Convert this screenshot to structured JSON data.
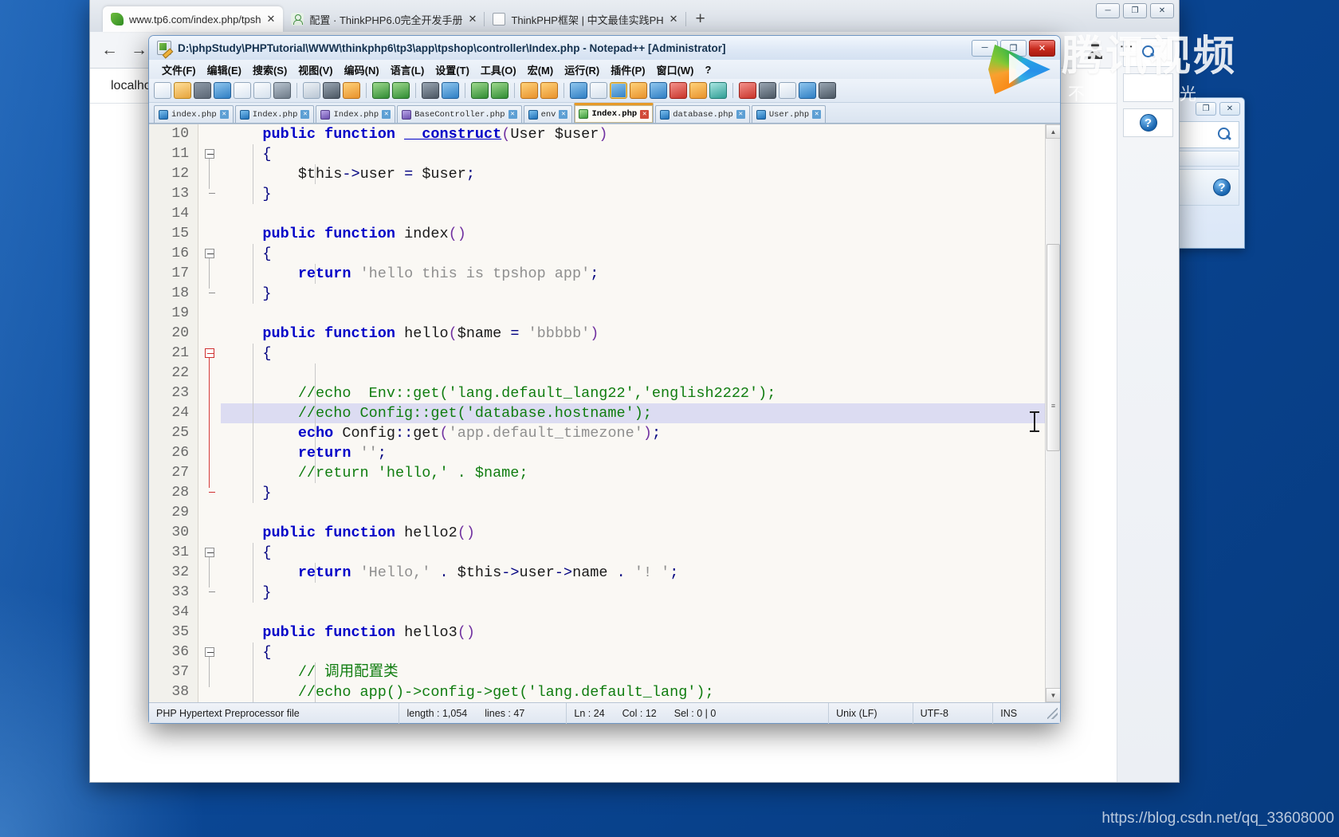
{
  "browser": {
    "tabs": [
      {
        "label": "www.tp6.com/index.php/tpsh",
        "icon": "leaf-icon",
        "active": true
      },
      {
        "label": "配置 · ThinkPHP6.0完全开发手册",
        "icon": "person-icon",
        "active": false
      },
      {
        "label": "ThinkPHP框架 | 中文最佳实践PH",
        "icon": "document-icon",
        "active": false
      }
    ],
    "newtab_label": "+",
    "close_label": "✕",
    "back_label": "←",
    "forward_label": "→",
    "urlbar_value": "localho",
    "window_controls": {
      "minimize": "─",
      "maximize": "❐",
      "close": "✕"
    }
  },
  "notepad": {
    "title": "D:\\phpStudy\\PHPTutorial\\WWW\\thinkphp6\\tp3\\app\\tpshop\\controller\\Index.php - Notepad++ [Administrator]",
    "window_controls": {
      "minimize": "─",
      "maximize": "❐",
      "close": "✕"
    },
    "menu": [
      "文件(F)",
      "编辑(E)",
      "搜索(S)",
      "视图(V)",
      "编码(N)",
      "语言(L)",
      "设置(T)",
      "工具(O)",
      "宏(M)",
      "运行(R)",
      "插件(P)",
      "窗口(W)",
      "?"
    ],
    "file_tabs": [
      {
        "label": "index.php",
        "icon_color": "blue",
        "active": false
      },
      {
        "label": "Index.php",
        "icon_color": "blue",
        "active": false
      },
      {
        "label": "Index.php",
        "icon_color": "purple",
        "active": false
      },
      {
        "label": "BaseController.php",
        "icon_color": "purple",
        "active": false
      },
      {
        "label": "env",
        "icon_color": "blue",
        "active": false
      },
      {
        "label": "Index.php",
        "icon_color": "green",
        "active": true
      },
      {
        "label": "database.php",
        "icon_color": "blue",
        "active": false
      },
      {
        "label": "User.php",
        "icon_color": "blue",
        "active": false
      }
    ],
    "tab_close_glyph": "✕",
    "status": {
      "file_type": "PHP Hypertext Preprocessor file",
      "length_label": "length : 1,054",
      "lines_label": "lines : 47",
      "ln_label": "Ln : 24",
      "col_label": "Col : 12",
      "sel_label": "Sel : 0 | 0",
      "eol": "Unix (LF)",
      "encoding": "UTF-8",
      "insert_mode": "INS"
    },
    "scrollbar": {
      "up_arrow": "▲",
      "down_arrow": "▼",
      "marker": "≡"
    },
    "code": [
      {
        "n": "10",
        "fold": "none",
        "hl": false,
        "tokens": [
          {
            "t": "    ",
            "c": "plain"
          },
          {
            "t": "public",
            "c": "kw"
          },
          {
            "t": " ",
            "c": "plain"
          },
          {
            "t": "function",
            "c": "kw"
          },
          {
            "t": " ",
            "c": "plain"
          },
          {
            "t": "__construct",
            "c": "ctor"
          },
          {
            "t": "(",
            "c": "paren"
          },
          {
            "t": "User ",
            "c": "id"
          },
          {
            "t": "$user",
            "c": "var"
          },
          {
            "t": ")",
            "c": "paren"
          }
        ]
      },
      {
        "n": "11",
        "fold": "open",
        "hl": false,
        "tokens": [
          {
            "t": "    ",
            "c": "plain"
          },
          {
            "t": "{",
            "c": "op"
          }
        ]
      },
      {
        "n": "12",
        "fold": "bar",
        "hl": false,
        "tokens": [
          {
            "t": "        ",
            "c": "plain"
          },
          {
            "t": "$this",
            "c": "var"
          },
          {
            "t": "->",
            "c": "op"
          },
          {
            "t": "user",
            "c": "id"
          },
          {
            "t": " ",
            "c": "plain"
          },
          {
            "t": "=",
            "c": "op"
          },
          {
            "t": " ",
            "c": "plain"
          },
          {
            "t": "$user",
            "c": "var"
          },
          {
            "t": ";",
            "c": "op"
          }
        ]
      },
      {
        "n": "13",
        "fold": "end",
        "hl": false,
        "tokens": [
          {
            "t": "    ",
            "c": "plain"
          },
          {
            "t": "}",
            "c": "op"
          }
        ]
      },
      {
        "n": "14",
        "fold": "none",
        "hl": false,
        "tokens": []
      },
      {
        "n": "15",
        "fold": "none",
        "hl": false,
        "tokens": [
          {
            "t": "    ",
            "c": "plain"
          },
          {
            "t": "public",
            "c": "kw"
          },
          {
            "t": " ",
            "c": "plain"
          },
          {
            "t": "function",
            "c": "kw"
          },
          {
            "t": " ",
            "c": "plain"
          },
          {
            "t": "index",
            "c": "fn"
          },
          {
            "t": "()",
            "c": "paren"
          }
        ]
      },
      {
        "n": "16",
        "fold": "open",
        "hl": false,
        "tokens": [
          {
            "t": "    ",
            "c": "plain"
          },
          {
            "t": "{",
            "c": "op"
          }
        ]
      },
      {
        "n": "17",
        "fold": "bar",
        "hl": false,
        "tokens": [
          {
            "t": "        ",
            "c": "plain"
          },
          {
            "t": "return",
            "c": "kw"
          },
          {
            "t": " ",
            "c": "plain"
          },
          {
            "t": "'hello this is tpshop app'",
            "c": "str"
          },
          {
            "t": ";",
            "c": "op"
          }
        ]
      },
      {
        "n": "18",
        "fold": "end",
        "hl": false,
        "tokens": [
          {
            "t": "    ",
            "c": "plain"
          },
          {
            "t": "}",
            "c": "op"
          }
        ]
      },
      {
        "n": "19",
        "fold": "none",
        "hl": false,
        "tokens": []
      },
      {
        "n": "20",
        "fold": "none",
        "hl": false,
        "tokens": [
          {
            "t": "    ",
            "c": "plain"
          },
          {
            "t": "public",
            "c": "kw"
          },
          {
            "t": " ",
            "c": "plain"
          },
          {
            "t": "function",
            "c": "kw"
          },
          {
            "t": " ",
            "c": "plain"
          },
          {
            "t": "hello",
            "c": "fn"
          },
          {
            "t": "(",
            "c": "paren"
          },
          {
            "t": "$name",
            "c": "var"
          },
          {
            "t": " ",
            "c": "plain"
          },
          {
            "t": "=",
            "c": "op"
          },
          {
            "t": " ",
            "c": "plain"
          },
          {
            "t": "'bbbbb'",
            "c": "str"
          },
          {
            "t": ")",
            "c": "paren"
          }
        ]
      },
      {
        "n": "21",
        "fold": "openred",
        "hl": false,
        "tokens": [
          {
            "t": "    ",
            "c": "plain"
          },
          {
            "t": "{",
            "c": "op"
          }
        ]
      },
      {
        "n": "22",
        "fold": "barred",
        "hl": false,
        "tokens": []
      },
      {
        "n": "23",
        "fold": "barred",
        "hl": false,
        "tokens": [
          {
            "t": "        ",
            "c": "plain"
          },
          {
            "t": "//echo  Env::get('lang.default_lang22','english2222');",
            "c": "cmt"
          }
        ]
      },
      {
        "n": "24",
        "fold": "barred",
        "hl": true,
        "tokens": [
          {
            "t": "        ",
            "c": "plain"
          },
          {
            "t": "//echo Config::get('database.hostname');",
            "c": "cmt"
          }
        ]
      },
      {
        "n": "25",
        "fold": "barred",
        "hl": false,
        "tokens": [
          {
            "t": "        ",
            "c": "plain"
          },
          {
            "t": "echo",
            "c": "kw"
          },
          {
            "t": " ",
            "c": "plain"
          },
          {
            "t": "Config",
            "c": "id"
          },
          {
            "t": "::",
            "c": "op"
          },
          {
            "t": "get",
            "c": "fn"
          },
          {
            "t": "(",
            "c": "paren"
          },
          {
            "t": "'app.default_timezone'",
            "c": "str"
          },
          {
            "t": ")",
            "c": "paren"
          },
          {
            "t": ";",
            "c": "op"
          }
        ]
      },
      {
        "n": "26",
        "fold": "barred",
        "hl": false,
        "tokens": [
          {
            "t": "        ",
            "c": "plain"
          },
          {
            "t": "return",
            "c": "kw"
          },
          {
            "t": " ",
            "c": "plain"
          },
          {
            "t": "''",
            "c": "str"
          },
          {
            "t": ";",
            "c": "op"
          }
        ]
      },
      {
        "n": "27",
        "fold": "barred",
        "hl": false,
        "tokens": [
          {
            "t": "        ",
            "c": "plain"
          },
          {
            "t": "//return 'hello,' . $name;",
            "c": "cmt"
          }
        ]
      },
      {
        "n": "28",
        "fold": "endred",
        "hl": false,
        "tokens": [
          {
            "t": "    ",
            "c": "plain"
          },
          {
            "t": "}",
            "c": "op"
          }
        ]
      },
      {
        "n": "29",
        "fold": "none",
        "hl": false,
        "tokens": []
      },
      {
        "n": "30",
        "fold": "none",
        "hl": false,
        "tokens": [
          {
            "t": "    ",
            "c": "plain"
          },
          {
            "t": "public",
            "c": "kw"
          },
          {
            "t": " ",
            "c": "plain"
          },
          {
            "t": "function",
            "c": "kw"
          },
          {
            "t": " ",
            "c": "plain"
          },
          {
            "t": "hello2",
            "c": "fn"
          },
          {
            "t": "()",
            "c": "paren"
          }
        ]
      },
      {
        "n": "31",
        "fold": "open",
        "hl": false,
        "tokens": [
          {
            "t": "    ",
            "c": "plain"
          },
          {
            "t": "{",
            "c": "op"
          }
        ]
      },
      {
        "n": "32",
        "fold": "bar",
        "hl": false,
        "tokens": [
          {
            "t": "        ",
            "c": "plain"
          },
          {
            "t": "return",
            "c": "kw"
          },
          {
            "t": " ",
            "c": "plain"
          },
          {
            "t": "'Hello,'",
            "c": "str"
          },
          {
            "t": " ",
            "c": "plain"
          },
          {
            "t": ".",
            "c": "op"
          },
          {
            "t": " ",
            "c": "plain"
          },
          {
            "t": "$this",
            "c": "var"
          },
          {
            "t": "->",
            "c": "op"
          },
          {
            "t": "user",
            "c": "id"
          },
          {
            "t": "->",
            "c": "op"
          },
          {
            "t": "name",
            "c": "id"
          },
          {
            "t": " ",
            "c": "plain"
          },
          {
            "t": ".",
            "c": "op"
          },
          {
            "t": " ",
            "c": "plain"
          },
          {
            "t": "'! '",
            "c": "str"
          },
          {
            "t": ";",
            "c": "op"
          }
        ]
      },
      {
        "n": "33",
        "fold": "end",
        "hl": false,
        "tokens": [
          {
            "t": "    ",
            "c": "plain"
          },
          {
            "t": "}",
            "c": "op"
          }
        ]
      },
      {
        "n": "34",
        "fold": "none",
        "hl": false,
        "tokens": []
      },
      {
        "n": "35",
        "fold": "none",
        "hl": false,
        "tokens": [
          {
            "t": "    ",
            "c": "plain"
          },
          {
            "t": "public",
            "c": "kw"
          },
          {
            "t": " ",
            "c": "plain"
          },
          {
            "t": "function",
            "c": "kw"
          },
          {
            "t": " ",
            "c": "plain"
          },
          {
            "t": "hello3",
            "c": "fn"
          },
          {
            "t": "()",
            "c": "paren"
          }
        ]
      },
      {
        "n": "36",
        "fold": "open",
        "hl": false,
        "tokens": [
          {
            "t": "    ",
            "c": "plain"
          },
          {
            "t": "{",
            "c": "op"
          }
        ]
      },
      {
        "n": "37",
        "fold": "bar",
        "hl": false,
        "tokens": [
          {
            "t": "        ",
            "c": "plain"
          },
          {
            "t": "// 调用配置类",
            "c": "cmt"
          }
        ]
      },
      {
        "n": "38",
        "fold": "bar",
        "hl": false,
        "tokens": [
          {
            "t": "        ",
            "c": "plain"
          },
          {
            "t": "//echo app()->config->get('lang.default_lang');",
            "c": "cmt"
          }
        ]
      }
    ]
  },
  "watermarks": {
    "tencent_main": "腾讯视频",
    "tencent_sub": "不负好时光",
    "csdn": "https://blog.csdn.net/qq_33608000"
  }
}
